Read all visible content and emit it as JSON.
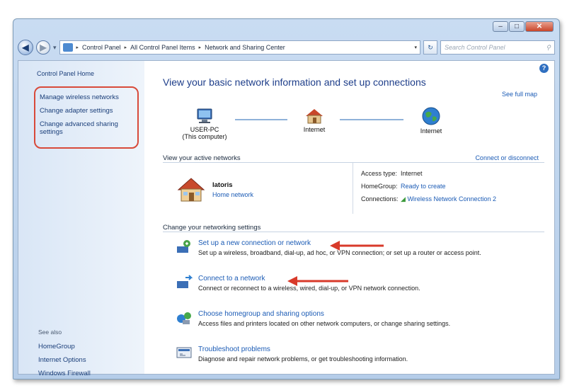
{
  "breadcrumb": [
    "Control Panel",
    "All Control Panel Items",
    "Network and Sharing Center"
  ],
  "search_placeholder": "Search Control Panel",
  "sidebar": {
    "home": "Control Panel Home",
    "tasks": [
      "Manage wireless networks",
      "Change adapter settings",
      "Change advanced sharing settings"
    ],
    "see_also_title": "See also",
    "see_also": [
      "HomeGroup",
      "Internet Options",
      "Windows Firewall"
    ]
  },
  "main": {
    "heading": "View your basic network information and set up connections",
    "see_full_map": "See full map",
    "map_nodes": [
      {
        "label": "USER-PC",
        "sub": "(This computer)"
      },
      {
        "label": "Internet",
        "sub": ""
      },
      {
        "label": "Internet",
        "sub": ""
      }
    ],
    "active_networks_title": "View your active networks",
    "connect_disconnect": "Connect or disconnect",
    "network_name": "latoris",
    "network_type": "Home network",
    "access_type_label": "Access type:",
    "access_type_value": "Internet",
    "homegroup_label": "HomeGroup:",
    "homegroup_value": "Ready to create",
    "connections_label": "Connections:",
    "connections_value": "Wireless Network Connection 2",
    "change_settings_title": "Change your networking settings",
    "tasks": [
      {
        "link": "Set up a new connection or network",
        "desc": "Set up a wireless, broadband, dial-up, ad hoc, or VPN connection; or set up a router or access point."
      },
      {
        "link": "Connect to a network",
        "desc": "Connect or reconnect to a wireless, wired, dial-up, or VPN network connection."
      },
      {
        "link": "Choose homegroup and sharing options",
        "desc": "Access files and printers located on other network computers, or change sharing settings."
      },
      {
        "link": "Troubleshoot problems",
        "desc": "Diagnose and repair network problems, or get troubleshooting information."
      }
    ]
  },
  "colors": {
    "highlight_circle": "#d84a3a",
    "arrow": "#d83a2a",
    "link": "#1b5bb5"
  }
}
